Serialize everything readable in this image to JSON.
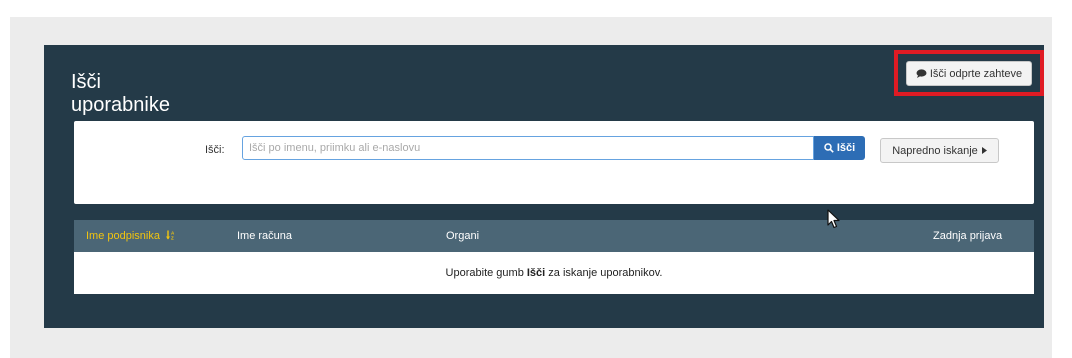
{
  "header": {
    "title_line1": "Išči",
    "title_line2": "uporabnike",
    "open_requests_label": "Išči odprte zahteve"
  },
  "search": {
    "label": "Išči:",
    "placeholder": "Išči po imenu, priimku ali e-naslovu",
    "value": "",
    "button_label": "Išči",
    "advanced_label": "Napredno iskanje"
  },
  "table": {
    "columns": [
      "Ime podpisnika",
      "Ime računa",
      "Organi",
      "Zadnja prijava"
    ],
    "empty_prefix": "Uporabite gumb ",
    "empty_bold": "Išči",
    "empty_suffix": " za iskanje uporabnikov."
  },
  "colors": {
    "panel_bg": "#243a48",
    "table_header_bg": "#4b6676",
    "active_sort": "#f1c40f",
    "primary_button": "#2d6db5",
    "highlight": "#e01b24"
  },
  "icons": {
    "open_requests": "chat-bubble-icon",
    "search": "magnifier-icon",
    "advanced": "caret-right-icon",
    "sort": "sort-alpha-icon"
  }
}
